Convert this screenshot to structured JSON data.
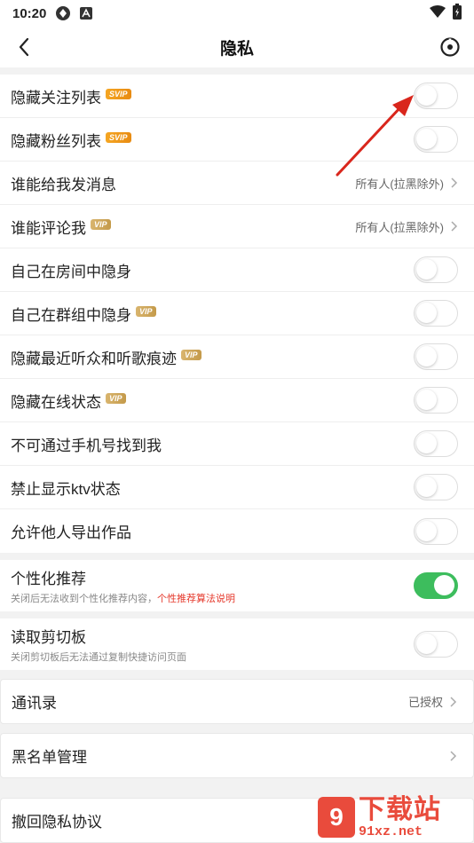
{
  "status_bar": {
    "time": "10:20"
  },
  "header": {
    "title": "隐私"
  },
  "section1": {
    "rows": [
      {
        "label": "隐藏关注列表",
        "badge": "SVIP",
        "type": "toggle",
        "on": false
      },
      {
        "label": "隐藏粉丝列表",
        "badge": "SVIP",
        "type": "toggle",
        "on": false
      },
      {
        "label": "谁能给我发消息",
        "type": "value",
        "value": "所有人(拉黑除外)"
      },
      {
        "label": "谁能评论我",
        "badge": "VIP",
        "type": "value",
        "value": "所有人(拉黑除外)"
      },
      {
        "label": "自己在房间中隐身",
        "type": "toggle",
        "on": false
      },
      {
        "label": "自己在群组中隐身",
        "badge": "VIP",
        "type": "toggle",
        "on": false
      },
      {
        "label": "隐藏最近听众和听歌痕迹",
        "badge": "VIP",
        "type": "toggle",
        "on": false
      },
      {
        "label": "隐藏在线状态",
        "badge": "VIP",
        "type": "toggle",
        "on": false
      },
      {
        "label": "不可通过手机号找到我",
        "type": "toggle",
        "on": false
      },
      {
        "label": "禁止显示ktv状态",
        "type": "toggle",
        "on": false
      },
      {
        "label": "允许他人导出作品",
        "type": "toggle",
        "on": false
      }
    ]
  },
  "personalized": {
    "label": "个性化推荐",
    "sub": "关闭后无法收到个性化推荐内容，",
    "link": "个性推荐算法说明",
    "on": true
  },
  "clipboard": {
    "label": "读取剪切板",
    "sub": "关闭剪切板后无法通过复制快捷访问页面",
    "on": false
  },
  "contacts": {
    "label": "通讯录",
    "value": "已授权"
  },
  "blacklist": {
    "label": "黑名单管理"
  },
  "revoke": {
    "label": "撤回隐私协议"
  },
  "watermark": {
    "cn": "下载站",
    "en": "91xz.net",
    "logo": "9"
  },
  "colors": {
    "toggle_on": "#3dbd5d",
    "link_red": "#e5392c",
    "annotation_arrow": "#d9261c"
  }
}
